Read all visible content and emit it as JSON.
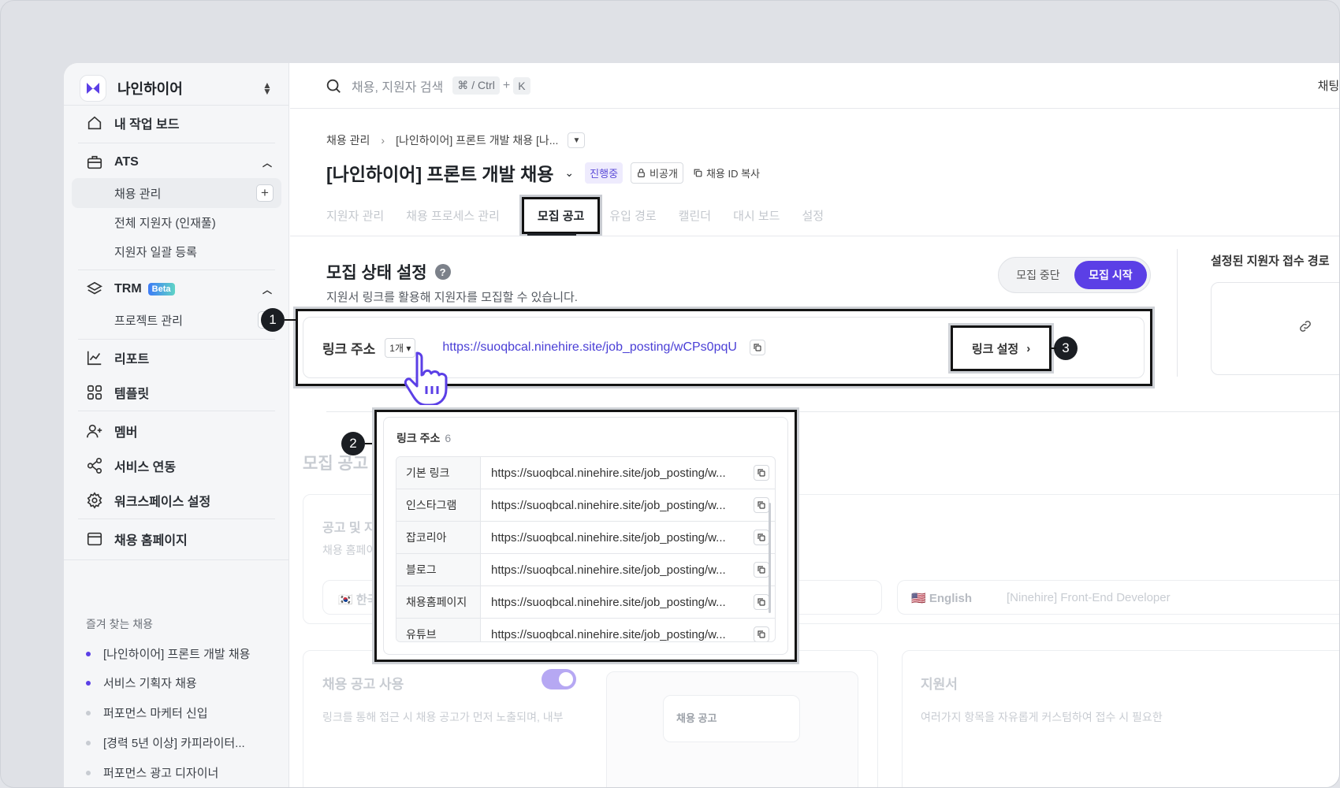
{
  "workspace": {
    "name": "나인하이어"
  },
  "sidebar": {
    "home": "내 작업 보드",
    "ats": {
      "label": "ATS",
      "items": [
        "채용 관리",
        "전체 지원자 (인재풀)",
        "지원자 일괄 등록"
      ]
    },
    "trm": {
      "label": "TRM",
      "badge": "Beta",
      "items": [
        "프로젝트 관리"
      ]
    },
    "report": "리포트",
    "template": "템플릿",
    "member": "멤버",
    "integration": "서비스 연동",
    "workspace_settings": "워크스페이스 설정",
    "homepage": "채용 홈페이지",
    "favorites_title": "즐겨 찾는 채용",
    "favorites": [
      "[나인하이어] 프론트 개발 채용",
      "서비스 기획자 채용",
      "퍼포먼스 마케터 신입",
      "[경력 5년 이상] 카피라이터...",
      "퍼포먼스 광고 디자이너"
    ]
  },
  "topbar": {
    "search_placeholder": "채용, 지원자 검색",
    "shortcut_1": "⌘ / Ctrl",
    "shortcut_plus": "+",
    "shortcut_2": "K",
    "chat": "채팅 상담"
  },
  "breadcrumb": {
    "root": "채용 관리",
    "current": "[나인하이어] 프론트 개발 채용 [나..."
  },
  "job": {
    "title": "[나인하이어] 프론트 개발 채용",
    "status": "진행중",
    "visibility": "비공개",
    "copy_id": "채용 ID 복사"
  },
  "tabs": [
    "지원자 관리",
    "채용 프로세스 관리",
    "모집 공고",
    "유입 경로",
    "캘린더",
    "대시 보드",
    "설정"
  ],
  "recruit": {
    "title": "모집 상태 설정",
    "desc": "지원서 링크를 활용해 지원자를 모집할 수 있습니다.",
    "toggle_off": "모집 중단",
    "toggle_on": "모집 시작",
    "right_title": "설정된 지원자 접수 경로"
  },
  "link": {
    "label": "링크 주소",
    "count": "1개",
    "url": "https://suoqbcal.ninehire.site/job_posting/wCPs0pqU",
    "settings": "링크 설정"
  },
  "popup": {
    "title": "링크 주소",
    "count": "6",
    "rows": [
      {
        "name": "기본 링크",
        "url": "https://suoqbcal.ninehire.site/job_posting/w..."
      },
      {
        "name": "인스타그램",
        "url": "https://suoqbcal.ninehire.site/job_posting/w..."
      },
      {
        "name": "잡코리아",
        "url": "https://suoqbcal.ninehire.site/job_posting/w..."
      },
      {
        "name": "블로그",
        "url": "https://suoqbcal.ninehire.site/job_posting/w..."
      },
      {
        "name": "채용홈페이지",
        "url": "https://suoqbcal.ninehire.site/job_posting/w..."
      },
      {
        "name": "유튜브",
        "url": "https://suoqbcal.ninehire.site/job_posting/w..."
      }
    ]
  },
  "annotations": [
    "1",
    "2",
    "3"
  ],
  "background": {
    "section2": "모집 공고 및",
    "card_title": "공고 및 지",
    "card_sub": "채용 홈페이",
    "lang_ko": "한국",
    "lang_en": "English",
    "lang_en_title": "[Ninehire] Front-End Developer",
    "use_title": "채용 공고 사용",
    "use_desc": "링크를 통해 접근 시 채용 공고가 먼저 노출되며, 내부",
    "preview_label": "채용 공고",
    "form_title": "지원서",
    "form_desc": "여러가지 항목을 자유롭게 커스텀하여 접수 시 필요한"
  }
}
